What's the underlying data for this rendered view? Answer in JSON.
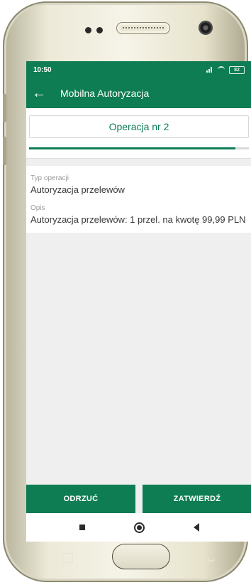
{
  "status_bar": {
    "time": "10:50",
    "battery": "82"
  },
  "toolbar": {
    "back_icon": "←",
    "title": "Mobilna Autoryzacja"
  },
  "operation": {
    "title": "Operacja nr 2",
    "progress": 0.94
  },
  "details": {
    "type_label": "Typ operacji",
    "type_value": "Autoryzacja przelewów",
    "desc_label": "Opis",
    "desc_value": "Autoryzacja przelewów: 1 przel. na kwotę 99,99 PLN"
  },
  "actions": {
    "reject_label": "ODRZUĆ",
    "confirm_label": "ZATWIERDŹ"
  },
  "colors": {
    "brand": "#0e7d53",
    "screen_bg": "#efefef"
  }
}
